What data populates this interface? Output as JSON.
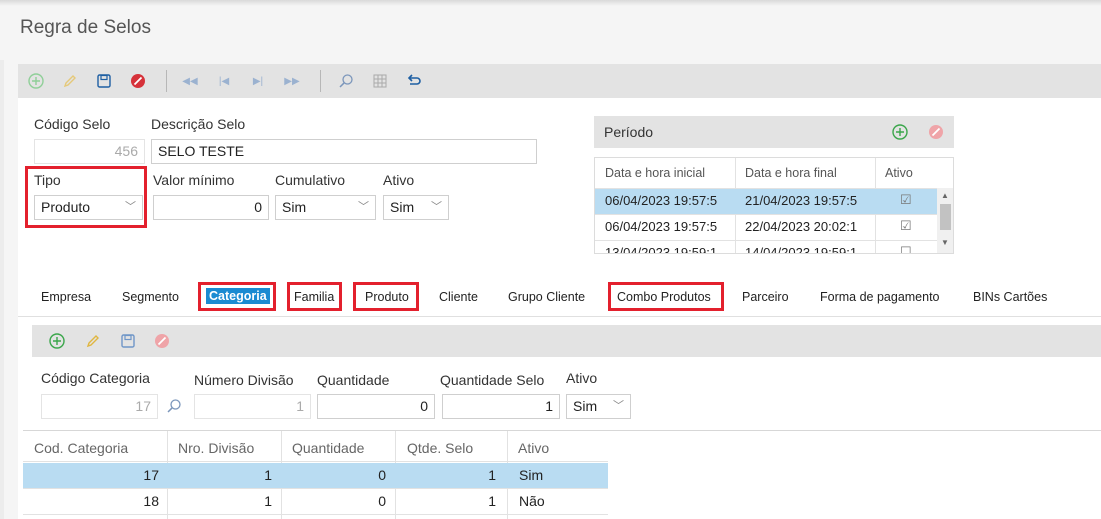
{
  "page": {
    "title": "Regra de Selos"
  },
  "colors": {
    "accent": "#1a8bd2",
    "highlight_row": "#b9dcf2",
    "toolbar_bg": "#e3e3e3",
    "red_box": "#e3202d",
    "add_green": "#3aa64a",
    "delete_red": "#d6323a",
    "icon_blue": "#1e5fa3"
  },
  "toolbar": {
    "icons": [
      "add-icon",
      "edit-icon",
      "save-icon",
      "delete-icon",
      "first-icon",
      "prev-icon",
      "next-icon",
      "last-icon",
      "search-icon",
      "grid-icon",
      "undo-icon"
    ]
  },
  "form": {
    "codigo_selo": {
      "label": "Código Selo",
      "value": "456"
    },
    "descricao_selo": {
      "label": "Descrição Selo",
      "value": "SELO TESTE"
    },
    "tipo": {
      "label": "Tipo",
      "value": "Produto"
    },
    "valor_minimo": {
      "label": "Valor mínimo",
      "value": "0"
    },
    "cumulativo": {
      "label": "Cumulativo",
      "value": "Sim"
    },
    "ativo": {
      "label": "Ativo",
      "value": "Sim"
    }
  },
  "periodo": {
    "title": "Período",
    "columns": [
      "Data e hora inicial",
      "Data e hora final",
      "Ativo"
    ],
    "rows": [
      {
        "inicio": "06/04/2023 19:57:5",
        "fim": "21/04/2023 19:57:5",
        "ativo": "☑",
        "selected": true
      },
      {
        "inicio": "06/04/2023 19:57:5",
        "fim": "22/04/2023 20:02:1",
        "ativo": "☑",
        "selected": false
      },
      {
        "inicio": "13/04/2023 19:59:1",
        "fim": "14/04/2023 19:59:1",
        "ativo": "☐",
        "selected": false
      }
    ]
  },
  "tabs": [
    {
      "label": "Empresa"
    },
    {
      "label": "Segmento"
    },
    {
      "label": "Categoria",
      "active": true
    },
    {
      "label": "Familia"
    },
    {
      "label": "Produto"
    },
    {
      "label": "Cliente"
    },
    {
      "label": "Grupo Cliente"
    },
    {
      "label": "Combo Produtos"
    },
    {
      "label": "Parceiro"
    },
    {
      "label": "Forma de pagamento"
    },
    {
      "label": "BINs Cartões"
    }
  ],
  "categoria_form": {
    "codigo_categoria": {
      "label": "Código Categoria",
      "value": "17"
    },
    "numero_divisao": {
      "label": "Número Divisão",
      "value": "1"
    },
    "quantidade": {
      "label": "Quantidade",
      "value": "0"
    },
    "quantidade_selo": {
      "label": "Quantidade Selo",
      "value": "1"
    },
    "ativo": {
      "label": "Ativo",
      "value": "Sim"
    }
  },
  "categoria_grid": {
    "columns": [
      "Cod. Categoria",
      "Nro. Divisão",
      "Quantidade",
      "Qtde. Selo",
      "Ativo"
    ],
    "rows": [
      {
        "cod": "17",
        "div": "1",
        "qtd": "0",
        "selo": "1",
        "ativo": "Sim",
        "selected": true
      },
      {
        "cod": "18",
        "div": "1",
        "qtd": "0",
        "selo": "1",
        "ativo": "Não",
        "selected": false
      }
    ]
  }
}
